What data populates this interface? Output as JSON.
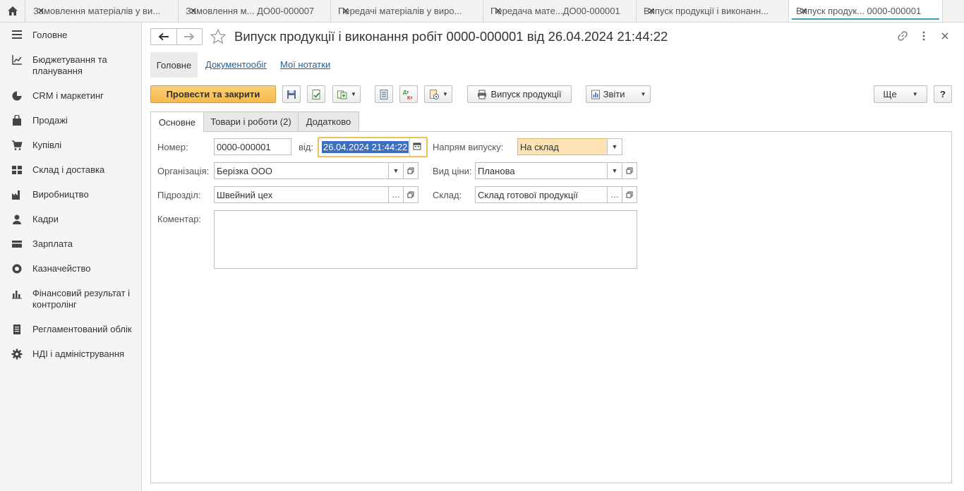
{
  "window_tabs": [
    {
      "label": "Замовлення матеріалів у ви...",
      "active": false
    },
    {
      "label": "Замовлення м... ДО00-000007",
      "active": false
    },
    {
      "label": "Передачі матеріалів у виро...",
      "active": false
    },
    {
      "label": "Передача мате...ДО00-000001",
      "active": false
    },
    {
      "label": "Випуск продукції і виконанн...",
      "active": false
    },
    {
      "label": "Випуск продук...  0000-000001",
      "active": true
    }
  ],
  "sidebar": {
    "items": [
      {
        "label": "Головне",
        "icon": "menu-icon"
      },
      {
        "label": "Бюджетування та планування",
        "icon": "chart-line-icon"
      },
      {
        "label": "CRM і маркетинг",
        "icon": "pie-chart-icon"
      },
      {
        "label": "Продажі",
        "icon": "shopping-bag-icon"
      },
      {
        "label": "Купівлі",
        "icon": "cart-icon"
      },
      {
        "label": "Склад і доставка",
        "icon": "grid-icon"
      },
      {
        "label": "Виробництво",
        "icon": "factory-icon"
      },
      {
        "label": "Кадри",
        "icon": "person-icon"
      },
      {
        "label": "Зарплата",
        "icon": "wallet-icon"
      },
      {
        "label": "Казначейство",
        "icon": "coin-icon"
      },
      {
        "label": "Фінансовий результат і контролінг",
        "icon": "bar-chart-icon"
      },
      {
        "label": "Регламентований облік",
        "icon": "document-icon"
      },
      {
        "label": "НДІ і адміністрування",
        "icon": "gear-icon"
      }
    ]
  },
  "header": {
    "title": "Випуск продукції і виконання робіт 0000-000001 від 26.04.2024 21:44:22"
  },
  "panel_tabs": {
    "main": "Головне",
    "docflow": "Документообіг",
    "notes": "Мої нотатки"
  },
  "toolbar": {
    "post_close": "Провести та закрити",
    "release": "Випуск продукції",
    "reports": "Звіти",
    "more": "Ще",
    "help": "?"
  },
  "form_tabs": {
    "basic": "Основне",
    "goods": "Товари і роботи (2)",
    "extra": "Додатково"
  },
  "form": {
    "number_label": "Номер:",
    "number_value": "0000-000001",
    "date_label": "від:",
    "date_value": "26.04.2024 21:44:22",
    "direction_label": "Напрям випуску:",
    "direction_value": "На склад",
    "org_label": "Організація:",
    "org_value": "Берізка ООО",
    "price_label": "Вид ціни:",
    "price_value": "Планова",
    "dept_label": "Підрозділ:",
    "dept_value": "Швейний цех",
    "warehouse_label": "Склад:",
    "warehouse_value": "Склад готової продукції",
    "comment_label": "Коментар:",
    "comment_value": ""
  }
}
